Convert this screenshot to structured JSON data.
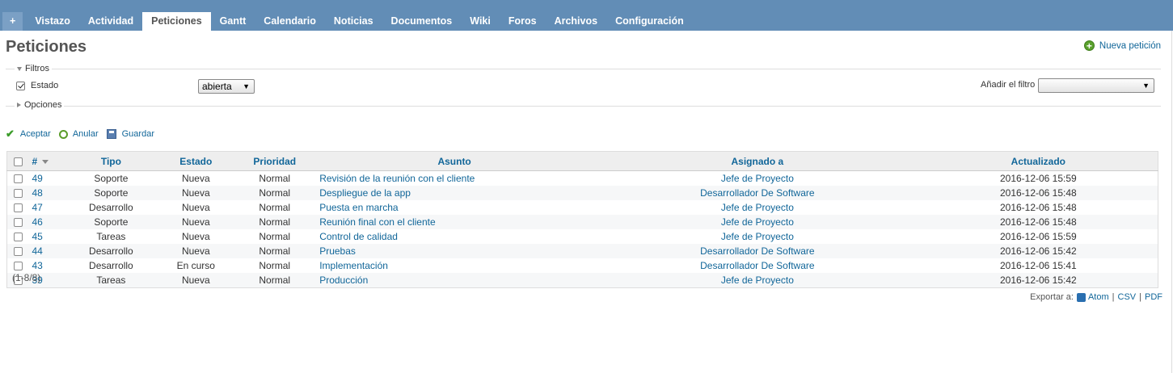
{
  "tabs": [
    {
      "label": "+",
      "name": "tab-new"
    },
    {
      "label": "Vistazo",
      "name": "tab-overview"
    },
    {
      "label": "Actividad",
      "name": "tab-activity"
    },
    {
      "label": "Peticiones",
      "name": "tab-issues",
      "selected": true
    },
    {
      "label": "Gantt",
      "name": "tab-gantt"
    },
    {
      "label": "Calendario",
      "name": "tab-calendar"
    },
    {
      "label": "Noticias",
      "name": "tab-news"
    },
    {
      "label": "Documentos",
      "name": "tab-documents"
    },
    {
      "label": "Wiki",
      "name": "tab-wiki"
    },
    {
      "label": "Foros",
      "name": "tab-forums"
    },
    {
      "label": "Archivos",
      "name": "tab-files"
    },
    {
      "label": "Configuración",
      "name": "tab-settings"
    }
  ],
  "page": {
    "title": "Peticiones",
    "new_issue": "Nueva petición"
  },
  "filters": {
    "legend": "Filtros",
    "estado_label": "Estado",
    "estado_value": "abierta",
    "add_filter_label": "Añadir el filtro",
    "add_filter_value": ""
  },
  "options": {
    "legend": "Opciones"
  },
  "actions": {
    "apply": "Aceptar",
    "clear": "Anular",
    "save": "Guardar"
  },
  "table": {
    "headers": {
      "id": "#",
      "tipo": "Tipo",
      "estado": "Estado",
      "prioridad": "Prioridad",
      "asunto": "Asunto",
      "asignado": "Asignado a",
      "actualizado": "Actualizado"
    },
    "rows": [
      {
        "id": "49",
        "tipo": "Soporte",
        "estado": "Nueva",
        "prioridad": "Normal",
        "asunto": "Revisión de la reunión con el cliente",
        "asignado": "Jefe de Proyecto",
        "actualizado": "2016-12-06 15:59"
      },
      {
        "id": "48",
        "tipo": "Soporte",
        "estado": "Nueva",
        "prioridad": "Normal",
        "asunto": "Despliegue de la app",
        "asignado": "Desarrollador De Software",
        "actualizado": "2016-12-06 15:48"
      },
      {
        "id": "47",
        "tipo": "Desarrollo",
        "estado": "Nueva",
        "prioridad": "Normal",
        "asunto": "Puesta en marcha",
        "asignado": "Jefe de Proyecto",
        "actualizado": "2016-12-06 15:48"
      },
      {
        "id": "46",
        "tipo": "Soporte",
        "estado": "Nueva",
        "prioridad": "Normal",
        "asunto": "Reunión final con el cliente",
        "asignado": "Jefe de Proyecto",
        "actualizado": "2016-12-06 15:48"
      },
      {
        "id": "45",
        "tipo": "Tareas",
        "estado": "Nueva",
        "prioridad": "Normal",
        "asunto": "Control de calidad",
        "asignado": "Jefe de Proyecto",
        "actualizado": "2016-12-06 15:59"
      },
      {
        "id": "44",
        "tipo": "Desarrollo",
        "estado": "Nueva",
        "prioridad": "Normal",
        "asunto": "Pruebas",
        "asignado": "Desarrollador De Software",
        "actualizado": "2016-12-06 15:42"
      },
      {
        "id": "43",
        "tipo": "Desarrollo",
        "estado": "En curso",
        "prioridad": "Normal",
        "asunto": "Implementación",
        "asignado": "Desarrollador De Software",
        "actualizado": "2016-12-06 15:41"
      },
      {
        "id": "39",
        "tipo": "Tareas",
        "estado": "Nueva",
        "prioridad": "Normal",
        "asunto": "Producción",
        "asignado": "Jefe de Proyecto",
        "actualizado": "2016-12-06 15:42"
      }
    ]
  },
  "pagination": "(1-8/8)",
  "export": {
    "label": "Exportar a:",
    "atom": "Atom",
    "csv": "CSV",
    "pdf": "PDF"
  },
  "colors": {
    "header_bar": "#628db6",
    "link": "#169",
    "accent_green": "#5aa02c"
  }
}
